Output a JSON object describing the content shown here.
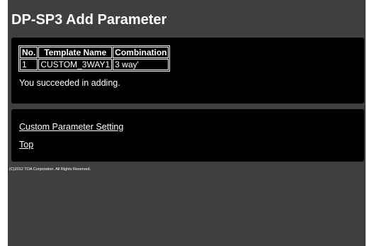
{
  "header": {
    "title": "DP-SP3 Add Parameter"
  },
  "result_table": {
    "headers": [
      "No.",
      "Template Name",
      "Combination"
    ],
    "rows": [
      [
        "1",
        "CUSTOM_3WAY1",
        "3 way'"
      ]
    ]
  },
  "status": {
    "message": "You succeeded in adding."
  },
  "links": {
    "custom_parameter_setting": "Custom Parameter Setting",
    "top": "Top"
  },
  "footer": {
    "copyright": "(C)2012 TOA Corporation. All Rights Reserved."
  },
  "colors": {
    "frame_background": "#3f3f3f",
    "panel_background": "#000000",
    "text": "#ffffff"
  }
}
